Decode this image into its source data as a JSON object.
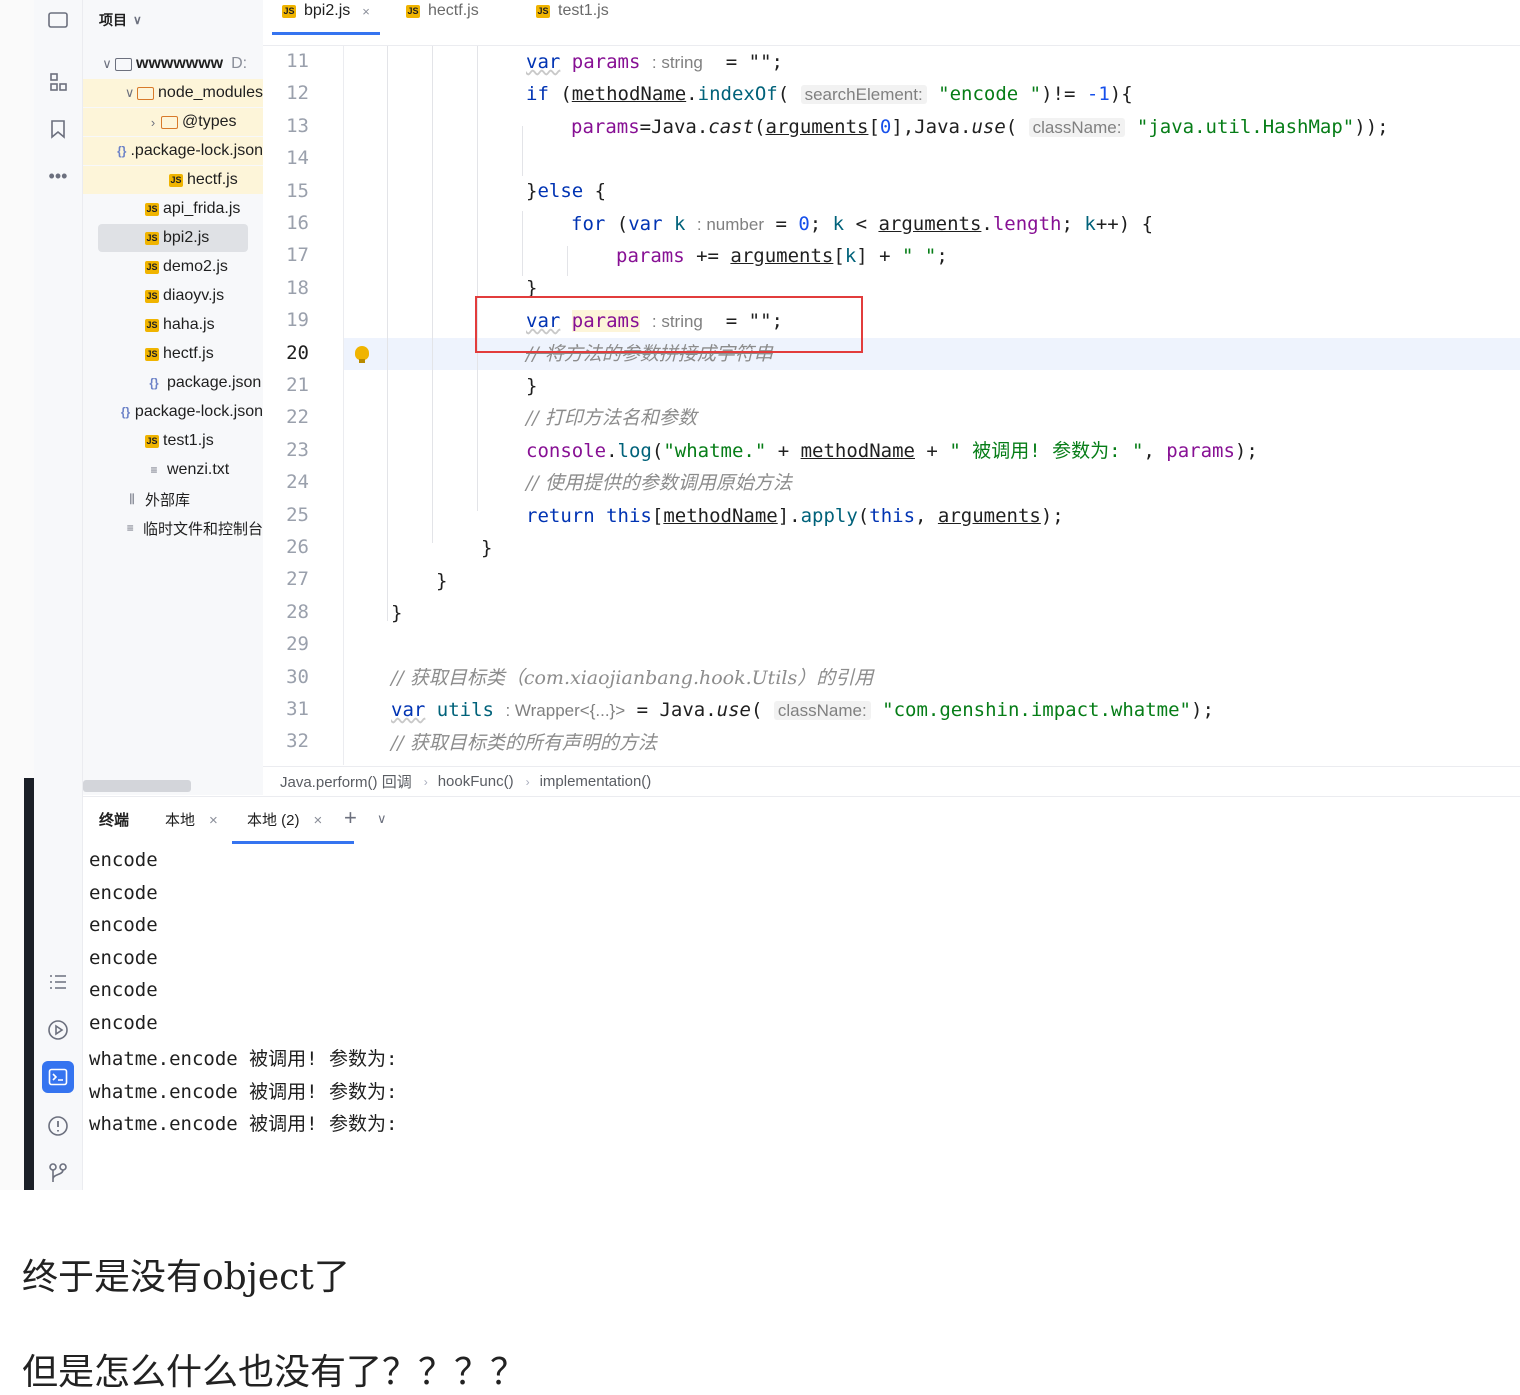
{
  "project_panel": {
    "header": "项目",
    "items": [
      {
        "chevron": "∨",
        "icon": "folder-icon",
        "label": "wwwwwww",
        "suffix": "D:"
      },
      {
        "chevron": "∨",
        "icon": "folder-icon",
        "label": "node_modules"
      },
      {
        "chevron": "›",
        "icon": "folder-icon",
        "label": "@types"
      },
      {
        "chevron": "",
        "icon": "json-icon",
        "label": ".package-lock.json"
      },
      {
        "chevron": "",
        "icon": "js-icon",
        "label": "hectf.js"
      },
      {
        "chevron": "",
        "icon": "js-icon",
        "label": "api_frida.js"
      },
      {
        "chevron": "",
        "icon": "js-icon",
        "label": "bpi2.js"
      },
      {
        "chevron": "",
        "icon": "js-icon",
        "label": "demo2.js"
      },
      {
        "chevron": "",
        "icon": "js-icon",
        "label": "diaoyv.js"
      },
      {
        "chevron": "",
        "icon": "js-icon",
        "label": "haha.js"
      },
      {
        "chevron": "",
        "icon": "js-icon",
        "label": "hectf.js"
      },
      {
        "chevron": "",
        "icon": "json-icon",
        "label": "package.json"
      },
      {
        "chevron": "",
        "icon": "json-icon",
        "label": "package-lock.json"
      },
      {
        "chevron": "",
        "icon": "js-icon",
        "label": "test1.js"
      },
      {
        "chevron": "",
        "icon": "text-file-icon",
        "label": "wenzi.txt"
      },
      {
        "chevron": "",
        "icon": "library-icon",
        "label": "外部库"
      },
      {
        "chevron": "",
        "icon": "scratch-icon",
        "label": "临时文件和控制台"
      }
    ]
  },
  "editor_tabs": [
    {
      "label": "bpi2.js",
      "icon_text": "JS",
      "close": "×"
    },
    {
      "label": "hectf.js",
      "icon_text": "JS"
    },
    {
      "label": "test1.js",
      "icon_text": "JS"
    }
  ],
  "line_numbers": [
    "11",
    "12",
    "13",
    "14",
    "15",
    "16",
    "17",
    "18",
    "19",
    "20",
    "21",
    "22",
    "23",
    "24",
    "25",
    "26",
    "27",
    "28",
    "29",
    "30",
    "31",
    "32"
  ],
  "code": {
    "l11": {
      "kw": "var",
      "name": "params",
      "hint": ": string",
      "rest": " = \"\";"
    },
    "l12": {
      "kw": "if",
      "p1": " (",
      "name": "methodName",
      "dot": ".",
      "fn": "indexOf",
      "p2": "( ",
      "hint": "searchElement:",
      "str": " \"encode \"",
      "rest1": ")!= ",
      "num": "-1",
      "rest2": "){"
    },
    "l13": {
      "name": "params",
      "t1": "=Java.",
      "cast": "cast",
      "t2": "(",
      "args": "arguments",
      "t3": "[",
      "num": "0",
      "t4": "],Java.",
      "use": "use",
      "t5": "( ",
      "hint": "className:",
      "str": " \"java.util.HashMap\"",
      "t6": "));"
    },
    "l15": {
      "t1": "}",
      "kw": "else",
      "t2": " {"
    },
    "l16": {
      "kw": "for",
      "t1": " (",
      "kw2": "var",
      "t2": " ",
      "k": "k",
      "hint": ": number",
      "t3": " = ",
      "num": "0",
      "t4": "; ",
      "k2": "k",
      "t5": " < ",
      "args": "arguments",
      "t6": ".",
      "len": "length",
      "t7": "; ",
      "k3": "k",
      "t8": "++) {"
    },
    "l17": {
      "name": "params",
      "t1": " += ",
      "args": "arguments",
      "t2": "[",
      "k": "k",
      "t3": "] + ",
      "str": "\" \"",
      "t4": ";"
    },
    "l18": {
      "t1": "}"
    },
    "l19": {
      "kw": "var",
      "name": "params",
      "hint": ": string",
      "rest": " = \"\";"
    },
    "l20": {
      "cm": "// 将方法的参数拼接成字符串"
    },
    "l21": {
      "t1": "}"
    },
    "l22": {
      "cm": "// 打印方法名和参数"
    },
    "l23": {
      "con": "console",
      "t1": ".",
      "fn": "log",
      "t2": "(",
      "str1": "\"whatme.\"",
      "t3": " + ",
      "name": "methodName",
      "t4": " + ",
      "str2": "\" 被调用! 参数为: \"",
      "t5": ", ",
      "params": "params",
      "t6": ");"
    },
    "l24": {
      "cm": "// 使用提供的参数调用原始方法"
    },
    "l25": {
      "kw": "return",
      "t1": " ",
      "kw2": "this",
      "t2": "[",
      "name": "methodName",
      "t3": "].",
      "fn": "apply",
      "t4": "(",
      "kw3": "this",
      "t5": ", ",
      "args": "arguments",
      "t6": ");"
    },
    "l26": {
      "t1": "}"
    },
    "l27": {
      "t1": "}"
    },
    "l28": {
      "t1": "}"
    },
    "l30": {
      "cm": "// 获取目标类（com.xiaojianbang.hook.Utils）的引用"
    },
    "l31": {
      "kw": "var",
      "name": "utils",
      "hint": ": Wrapper<{...}>",
      "t1": " = Java.",
      "use": "use",
      "t2": "( ",
      "hint2": "className:",
      "str": " \"com.genshin.impact.whatme\"",
      "t3": ");"
    },
    "l32": {
      "cm": "// 获取目标类的所有声明的方法"
    }
  },
  "breadcrumb": [
    "Java.perform() 回调",
    "hookFunc()",
    "implementation()"
  ],
  "terminal": {
    "tabs": [
      {
        "label": "终端"
      },
      {
        "label": "本地",
        "close": "×"
      },
      {
        "label": "本地 (2)",
        "close": "×"
      }
    ],
    "add": "+",
    "dropdown": "∨",
    "lines": [
      "encode",
      "encode",
      "encode",
      "encode",
      "encode",
      "encode",
      "whatme.encode 被调用! 参数为:",
      "whatme.encode 被调用! 参数为:",
      "whatme.encode 被调用! 参数为:"
    ]
  },
  "captions": {
    "line1": "终于是没有object了",
    "line2": "但是怎么什么也没有了？？？？"
  },
  "colors": {
    "accent": "#3574f0",
    "highlight_box": "#e23c3c",
    "keyword": "#0033b3",
    "string": "#067d17"
  }
}
